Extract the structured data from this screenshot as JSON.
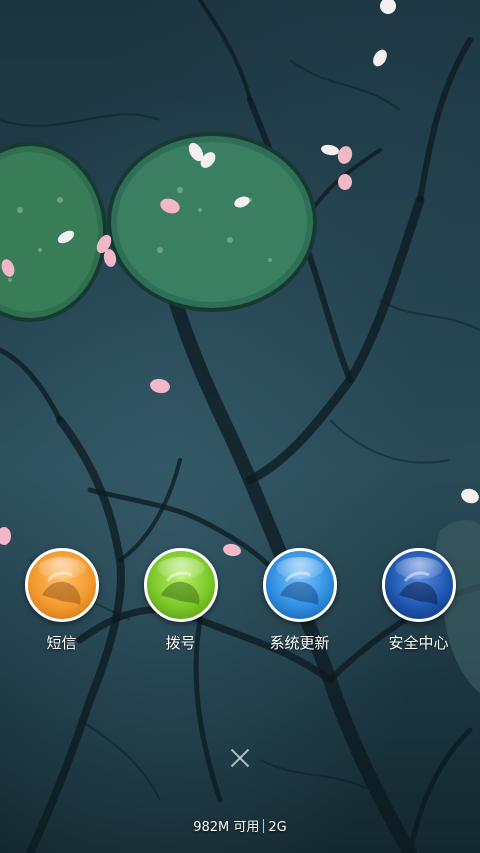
{
  "wallpaper": {
    "icon": "pond-lotus-wallpaper"
  },
  "dock": {
    "items": [
      {
        "label": "短信",
        "icon": "sms-orb-icon",
        "color": "#f39a2e"
      },
      {
        "label": "拨号",
        "icon": "dialer-orb-icon",
        "color": "#7cc828"
      },
      {
        "label": "系统更新",
        "icon": "system-update-orb-icon",
        "color": "#2f8fe0"
      },
      {
        "label": "安全中心",
        "icon": "security-center-orb-icon",
        "color": "#1f56b0"
      }
    ]
  },
  "close": {
    "icon": "close-icon"
  },
  "memory": {
    "available": "982M 可用",
    "network": "2G"
  }
}
